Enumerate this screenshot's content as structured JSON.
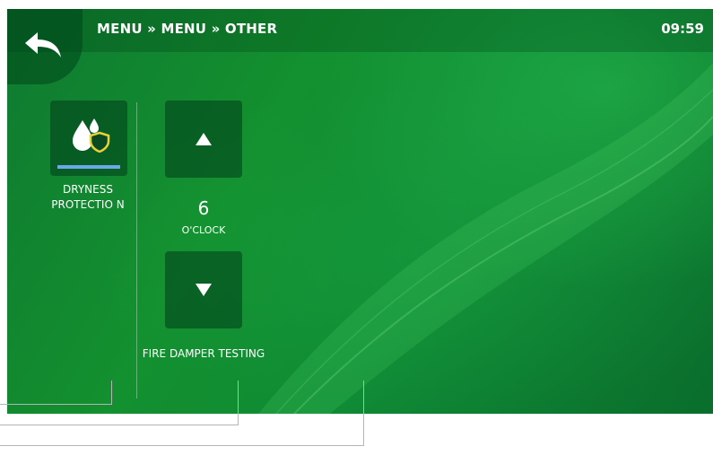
{
  "header": {
    "breadcrumb": "MENU » MENU » OTHER",
    "time": "09:59",
    "back_icon": "back-arrow-icon"
  },
  "dryness_protection": {
    "label": "DRYNESS PROTECTIO N",
    "icon": "water-drops-shield-icon"
  },
  "fire_damper": {
    "value": "6",
    "unit": "O'CLOCK",
    "label": "FIRE DAMPER TESTING",
    "up_icon": "arrow-up-icon",
    "down_icon": "arrow-down-icon"
  },
  "colors": {
    "background": "#13902f",
    "tile": "#0a4a22",
    "accent_underline": "#6aa8e8",
    "shield": "#e8d23a"
  }
}
